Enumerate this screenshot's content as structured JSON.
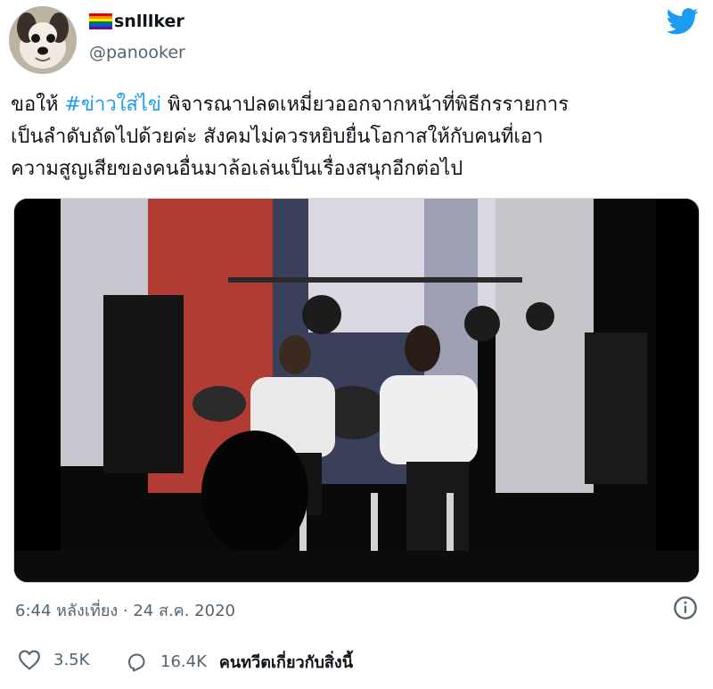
{
  "author": {
    "display_name": "snlllker",
    "handle": "@panooker",
    "flag_icon": "rainbow-flag-icon",
    "avatar_icon": "dog-avatar"
  },
  "brand": {
    "icon": "twitter-bird-icon",
    "color": "#1d9bf0"
  },
  "tweet": {
    "line1_prefix": "ขอให้ ",
    "hashtag": "#ข่าวใส่ไข่",
    "line1_suffix": " พิจารณาปลดเหมี่ยวออกจากหน้าที่พิธีกรรายการ",
    "line2": "เป็นลำดับถัดไปด้วยค่ะ สังคมไม่ควรหยิบยื่นโอกาสให้กับคนที่เอา",
    "line3": "ความสูญเสียของคนอื่นมาล้อเล่นเป็นเรื่องสนุกอีกต่อไป"
  },
  "media": {
    "type": "video-still",
    "description_icon": "stage-photo"
  },
  "timestamp": "6:44 หลังเที่ยง · 24 ส.ค. 2020",
  "actions": {
    "like_count": "3.5K",
    "reply_count": "16.4K",
    "reply_label": "คนทวีตเกี่ยวกับสิ่งนี้"
  },
  "colors": {
    "text": "#0f1419",
    "muted": "#536471",
    "accent": "#1d9bf0"
  }
}
